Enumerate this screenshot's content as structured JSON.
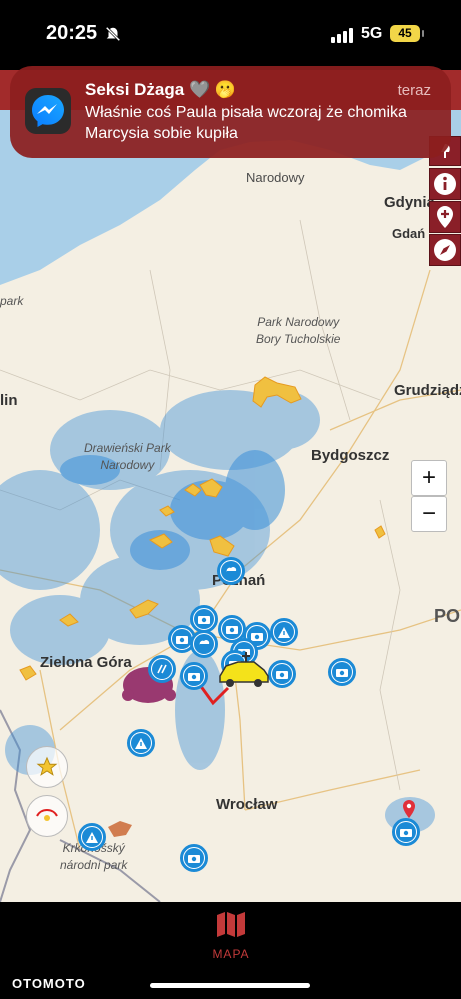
{
  "status": {
    "time": "20:25",
    "network": "5G",
    "battery": "45"
  },
  "notification": {
    "title": "Seksi Dżaga 🩶 🫢",
    "body": "Właśnie coś Paula pisała wczoraj że chomika Marcysia sobie kupiła",
    "time": "teraz",
    "app_icon": "messenger-icon"
  },
  "map": {
    "labels": {
      "narodowy_top": "Narodowy",
      "gdynia": "Gdynia",
      "gdansk": "Gdań",
      "park": "park",
      "bory_line1": "Park Narodowy",
      "bory_line2": "Bory Tucholskie",
      "grudziadz": "Grudziądz",
      "lin": "lin",
      "drawienski_line1": "Drawieński Park",
      "drawienski_line2": "Narodowy",
      "bydgoszcz": "Bydgoszcz",
      "poznan": "Poznań",
      "po": "PO",
      "zielona_gora": "Zielona Góra",
      "wroclaw": "Wrocław",
      "krkonossky_line1": "Krkonošský",
      "krkonossky_line2": "národní park"
    },
    "zoom_in": "+",
    "zoom_out": "−",
    "copyright": "©",
    "colors": {
      "rain": "#3b8fd9",
      "storm": "#f0c040",
      "poi": "#1b8ad6",
      "brand": "#8a1f28"
    }
  },
  "side_buttons": [
    "lamp-icon",
    "info-icon",
    "location-plus-icon",
    "compass-icon"
  ],
  "tabbar": {
    "label": "MAPA",
    "icon": "map-icon"
  },
  "watermark": "OTOMOTO"
}
